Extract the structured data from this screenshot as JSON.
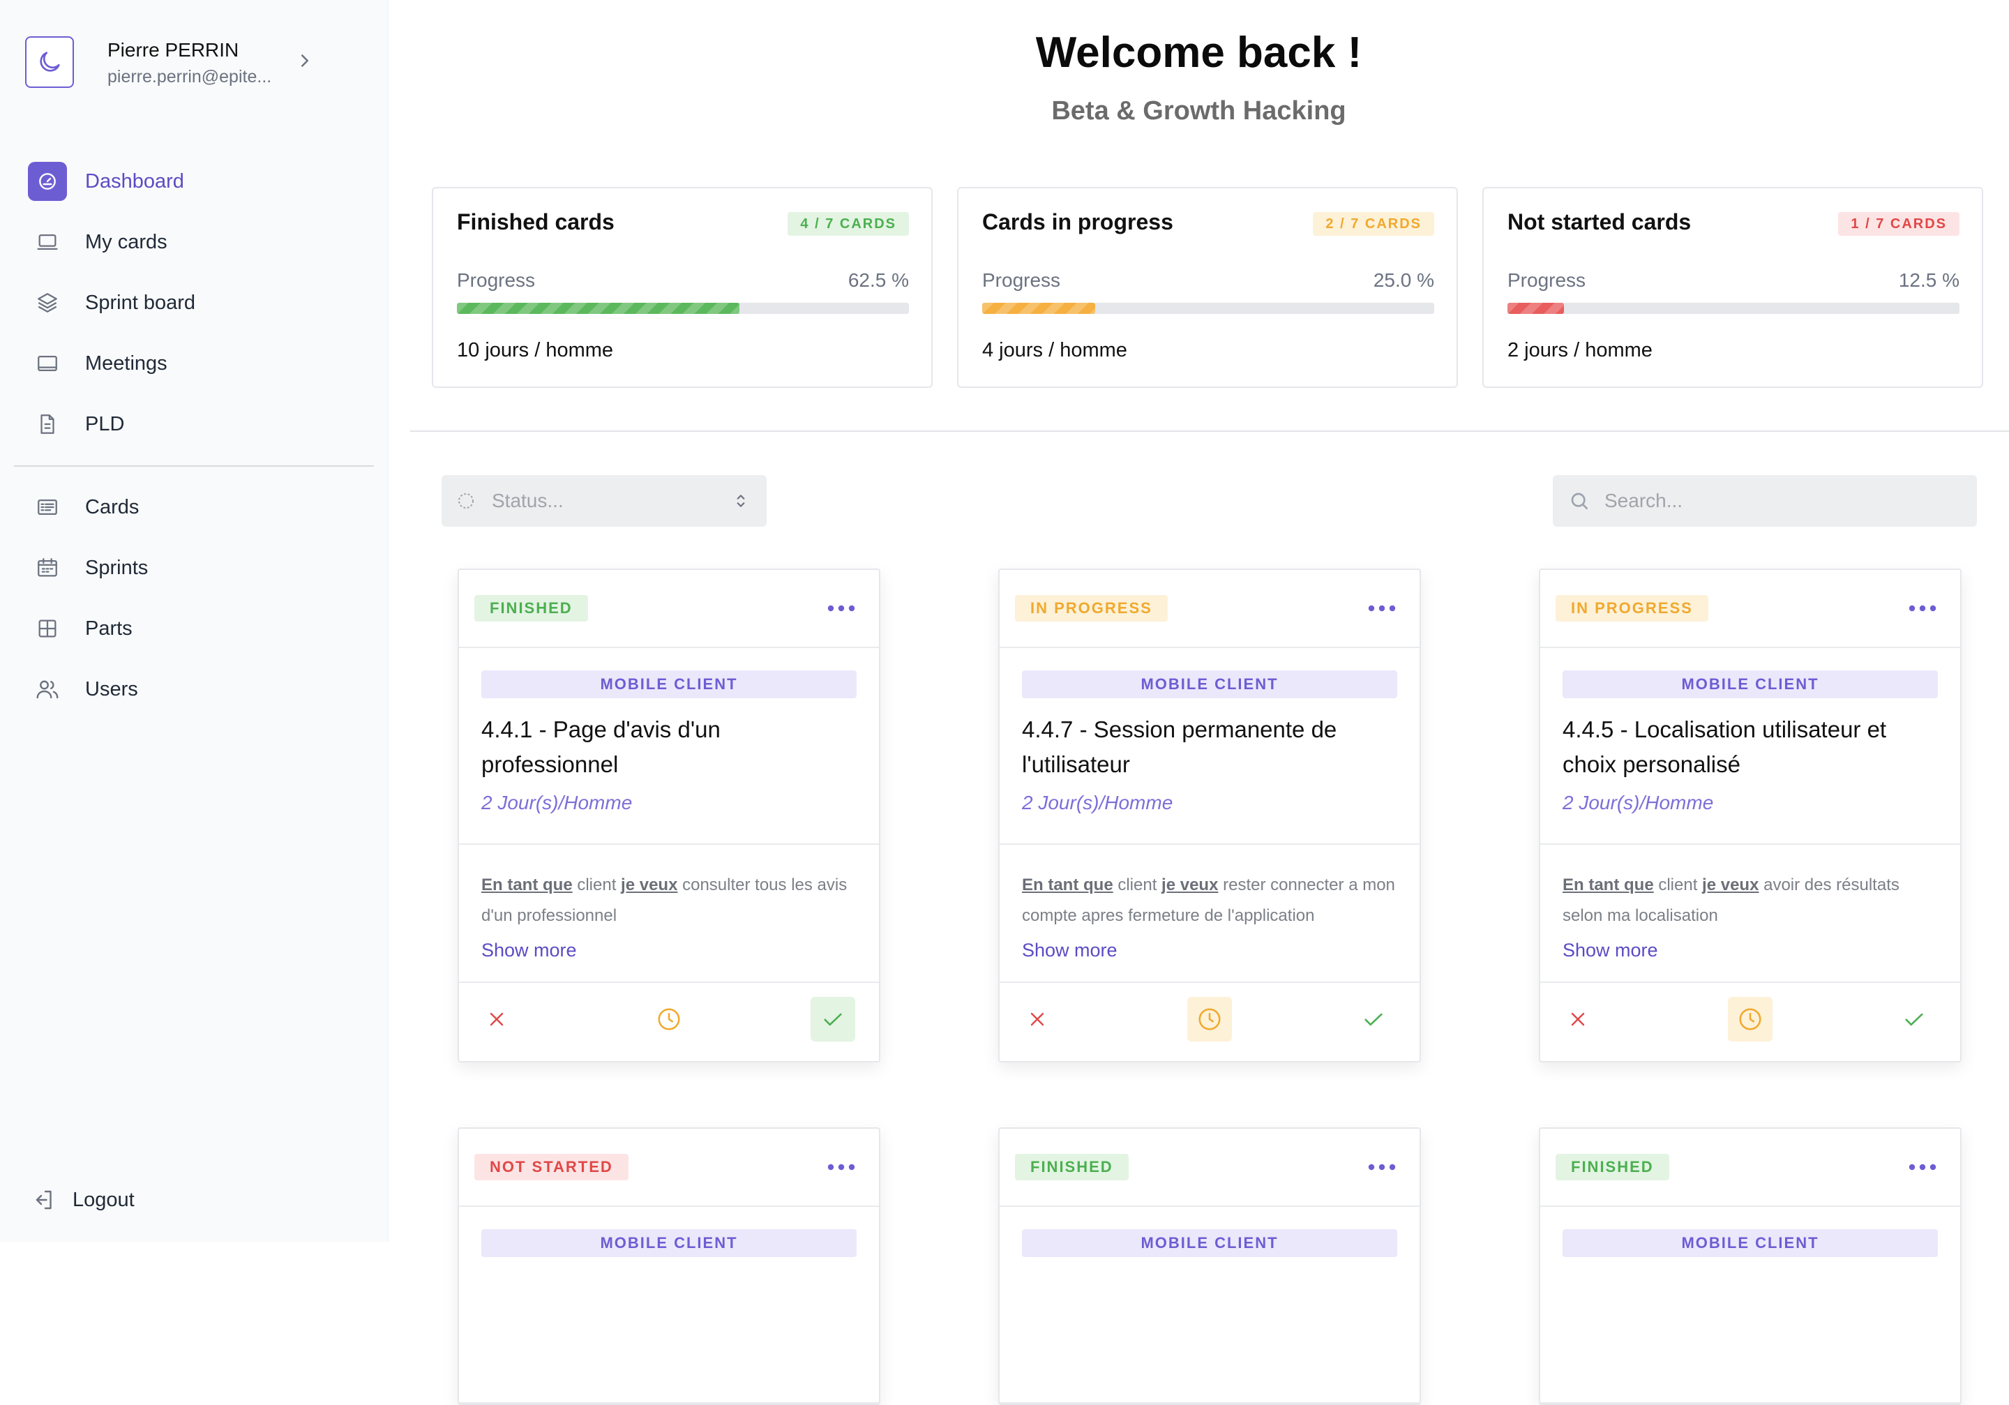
{
  "colors": {
    "accent": "#6d5dd3",
    "finished": "#5cb85c",
    "in_progress": "#f5b041",
    "not_started": "#e85d5d"
  },
  "profile": {
    "name": "Pierre PERRIN",
    "email": "pierre.perrin@epite...",
    "icon": "moon-icon"
  },
  "nav": {
    "items": [
      {
        "label": "Dashboard",
        "icon": "dashboard-icon",
        "active": true
      },
      {
        "label": "My cards",
        "icon": "laptop-icon"
      },
      {
        "label": "Sprint board",
        "icon": "layers-icon"
      },
      {
        "label": "Meetings",
        "icon": "screen-icon"
      },
      {
        "label": "PLD",
        "icon": "document-icon"
      },
      {
        "label": "Cards",
        "icon": "list-card-icon"
      },
      {
        "label": "Sprints",
        "icon": "calendar-icon"
      },
      {
        "label": "Parts",
        "icon": "grid-icon"
      },
      {
        "label": "Users",
        "icon": "users-icon"
      }
    ],
    "logout": "Logout"
  },
  "header": {
    "title": "Welcome back !",
    "subtitle": "Beta & Growth Hacking"
  },
  "stats": [
    {
      "title": "Finished cards",
      "badge": "4 / 7 CARDS",
      "progress_label": "Progress",
      "progress_value": "62.5 %",
      "progress": 62.5,
      "days": "10 jours / homme"
    },
    {
      "title": "Cards in progress",
      "badge": "2 / 7 CARDS",
      "progress_label": "Progress",
      "progress_value": "25.0 %",
      "progress": 25.0,
      "days": "4 jours / homme"
    },
    {
      "title": "Not started cards",
      "badge": "1 / 7 CARDS",
      "progress_label": "Progress",
      "progress_value": "12.5 %",
      "progress": 12.5,
      "days": "2 jours / homme"
    }
  ],
  "filters": {
    "status_placeholder": "Status...",
    "search_placeholder": "Search..."
  },
  "cards": [
    {
      "status": "FINISHED",
      "part": "MOBILE CLIENT",
      "title": "4.4.1 - Page d'avis d'un professionnel",
      "duration": "2 Jour(s)/Homme",
      "desc_as": "En tant que",
      "desc_role": " client ",
      "desc_want": "je veux",
      "desc_rest": " consulter tous les avis d'un professionnel",
      "show_more": "Show more"
    },
    {
      "status": "IN PROGRESS",
      "part": "MOBILE CLIENT",
      "title": "4.4.7 - Session permanente de l'utilisateur",
      "duration": "2 Jour(s)/Homme",
      "desc_as": "En tant que",
      "desc_role": " client ",
      "desc_want": "je veux",
      "desc_rest": " rester connecter a mon compte apres fermeture de l'application",
      "show_more": "Show more"
    },
    {
      "status": "IN PROGRESS",
      "part": "MOBILE CLIENT",
      "title": "4.4.5 - Localisation utilisateur et choix personalisé",
      "duration": "2 Jour(s)/Homme",
      "desc_as": "En tant que",
      "desc_role": " client ",
      "desc_want": "je veux",
      "desc_rest": " avoir des résultats selon ma localisation",
      "show_more": "Show more"
    },
    {
      "status": "NOT STARTED",
      "part": "MOBILE CLIENT"
    },
    {
      "status": "FINISHED",
      "part": "MOBILE CLIENT"
    },
    {
      "status": "FINISHED",
      "part": "MOBILE CLIENT"
    }
  ]
}
